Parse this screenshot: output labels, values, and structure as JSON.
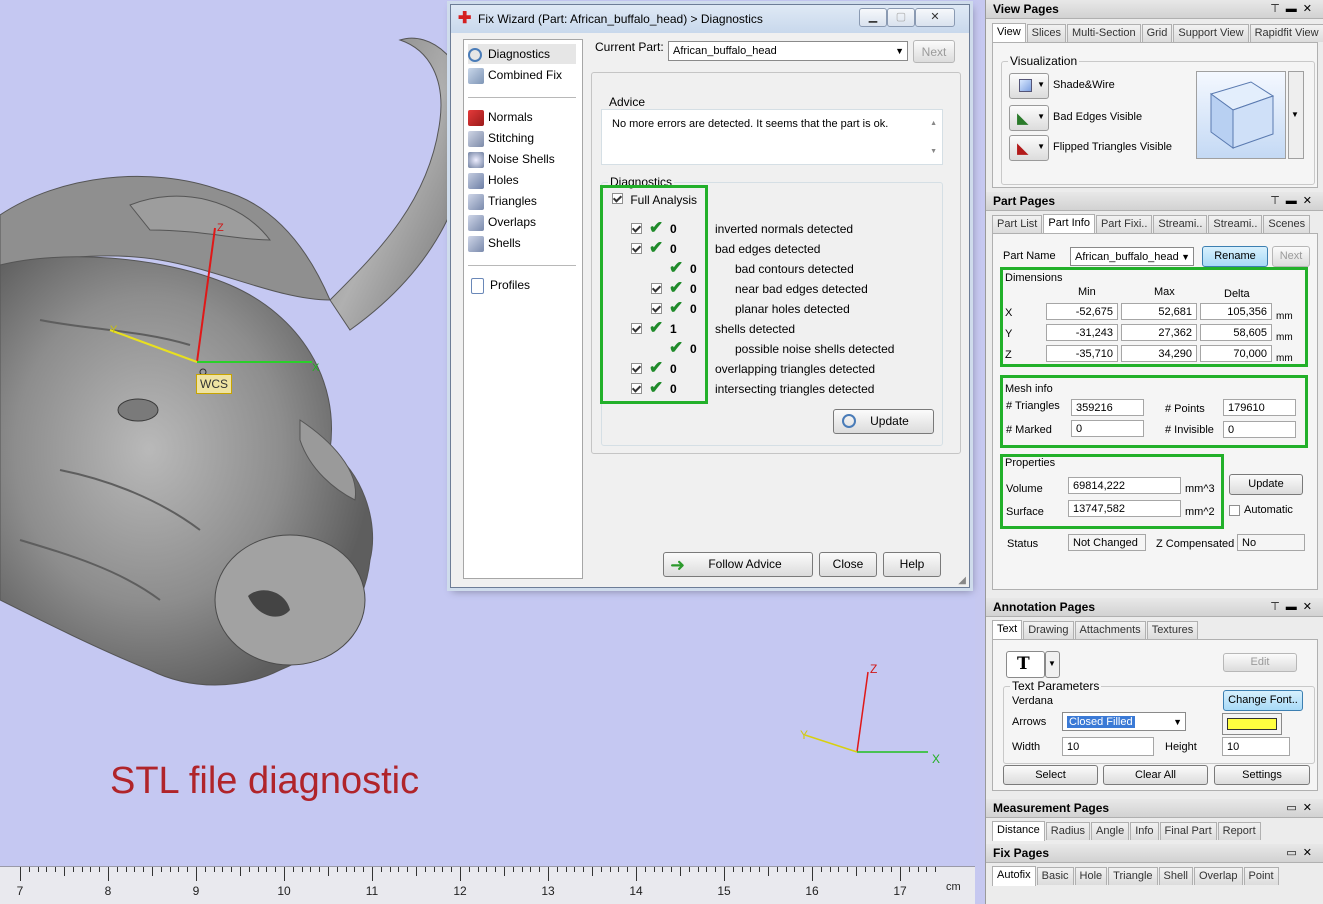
{
  "caption": "STL file diagnostic",
  "ruler": {
    "unit": "cm",
    "ticks": [
      "7",
      "8",
      "9",
      "10",
      "11",
      "12",
      "13",
      "14",
      "15",
      "16",
      "17"
    ]
  },
  "viewport": {
    "wcs_label": "WCS",
    "axis_z": "Z",
    "axis_y": "Y",
    "axis_x": "X"
  },
  "wizard": {
    "title": "Fix Wizard (Part: African_buffalo_head) > Diagnostics",
    "current_part_label": "Current Part:",
    "current_part_value": "African_buffalo_head",
    "next": "Next",
    "nav": {
      "diagnostics": "Diagnostics",
      "combined_fix": "Combined Fix",
      "normals": "Normals",
      "stitching": "Stitching",
      "noise_shells": "Noise Shells",
      "holes": "Holes",
      "triangles": "Triangles",
      "overlaps": "Overlaps",
      "shells": "Shells",
      "profiles": "Profiles"
    },
    "advice_label": "Advice",
    "advice_text": "No more errors are detected. It seems that the part is ok.",
    "diagnostics_label": "Diagnostics",
    "full_analysis": "Full Analysis",
    "results": [
      {
        "count": "0",
        "label": "inverted normals detected"
      },
      {
        "count": "0",
        "label": "bad edges detected"
      },
      {
        "count": "0",
        "label": "bad contours detected"
      },
      {
        "count": "0",
        "label": "near bad edges detected"
      },
      {
        "count": "0",
        "label": "planar holes detected"
      },
      {
        "count": "1",
        "label": "shells detected"
      },
      {
        "count": "0",
        "label": "possible noise shells detected"
      },
      {
        "count": "0",
        "label": "overlapping triangles detected"
      },
      {
        "count": "0",
        "label": "intersecting triangles detected"
      }
    ],
    "update": "Update",
    "follow_advice": "Follow Advice",
    "close": "Close",
    "help": "Help"
  },
  "view_pages": {
    "title": "View Pages",
    "tabs": [
      "View",
      "Slices",
      "Multi-Section",
      "Grid",
      "Support View",
      "Rapidfit View"
    ],
    "visualization_label": "Visualization",
    "shade_wire": "Shade&Wire",
    "bad_edges": "Bad Edges Visible",
    "flipped": "Flipped Triangles Visible"
  },
  "part_pages": {
    "title": "Part Pages",
    "tabs": [
      "Part List",
      "Part Info",
      "Part Fixi..",
      "Streami..",
      "Streami..",
      "Scenes"
    ],
    "part_name_label": "Part Name",
    "part_name_value": "African_buffalo_head",
    "rename": "Rename",
    "next": "Next",
    "dimensions_label": "Dimensions",
    "col_min": "Min",
    "col_max": "Max",
    "col_delta": "Delta",
    "dims": [
      {
        "axis": "X",
        "min": "-52,675",
        "max": "52,681",
        "delta": "105,356",
        "unit": "mm"
      },
      {
        "axis": "Y",
        "min": "-31,243",
        "max": "27,362",
        "delta": "58,605",
        "unit": "mm"
      },
      {
        "axis": "Z",
        "min": "-35,710",
        "max": "34,290",
        "delta": "70,000",
        "unit": "mm"
      }
    ],
    "mesh_label": "Mesh info",
    "triangles_label": "# Triangles",
    "triangles": "359216",
    "points_label": "# Points",
    "points": "179610",
    "marked_label": "# Marked",
    "marked": "0",
    "invisible_label": "# Invisible",
    "invisible": "0",
    "properties_label": "Properties",
    "volume_label": "Volume",
    "volume": "69814,222",
    "volume_unit": "mm^3",
    "surface_label": "Surface",
    "surface": "13747,582",
    "surface_unit": "mm^2",
    "update": "Update",
    "automatic": "Automatic",
    "status_label": "Status",
    "status": "Not Changed",
    "zcomp_label": "Z Compensated",
    "zcomp": "No"
  },
  "annotation_pages": {
    "title": "Annotation Pages",
    "tabs": [
      "Text",
      "Drawing",
      "Attachments",
      "Textures"
    ],
    "text_tool": "T",
    "edit": "Edit",
    "text_params_label": "Text Parameters",
    "font_name": "Verdana",
    "change_font": "Change Font..",
    "arrows_label": "Arrows",
    "arrows_value": "Closed Filled",
    "color": "#ffff40",
    "width_label": "Width",
    "width": "10",
    "height_label": "Height",
    "height": "10",
    "select": "Select",
    "clear_all": "Clear All",
    "settings": "Settings"
  },
  "measurement_pages": {
    "title": "Measurement Pages",
    "tabs": [
      "Distance",
      "Radius",
      "Angle",
      "Info",
      "Final Part",
      "Report"
    ]
  },
  "fix_pages": {
    "title": "Fix Pages",
    "tabs": [
      "Autofix",
      "Basic",
      "Hole",
      "Triangle",
      "Shell",
      "Overlap",
      "Point"
    ]
  }
}
